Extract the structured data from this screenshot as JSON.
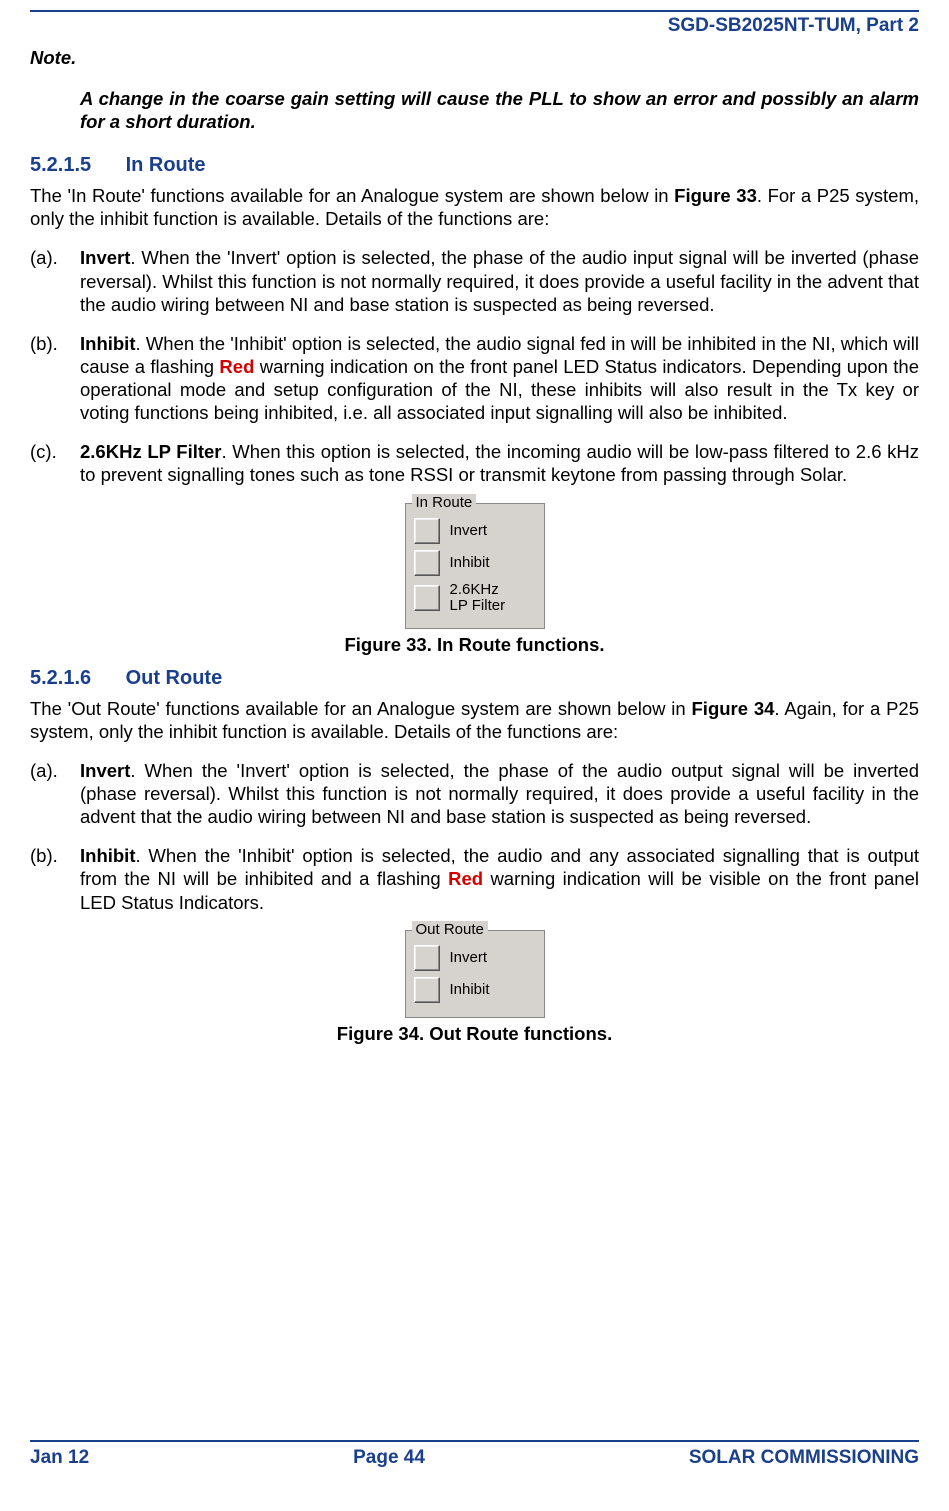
{
  "header": {
    "doc_id": "SGD-SB2025NT-TUM, Part 2"
  },
  "note": {
    "label": "Note.",
    "body": "A change in the coarse gain setting will cause the PLL to show an error and possibly an alarm for a short duration."
  },
  "sec_in_route": {
    "number": "5.2.1.5",
    "title": "In Route",
    "intro_1": "The 'In Route' functions available for an Analogue system are shown below in ",
    "intro_fig": "Figure 33",
    "intro_2": ".  For a P25 system, only the inhibit function is available.  Details of the functions are:",
    "a_marker": "(a).",
    "a_head": "Invert",
    "a_body": ".   When the 'Invert' option is selected, the phase of the audio input signal will be inverted (phase reversal).   Whilst this function is not normally required, it does provide a useful facility in the advent that the audio wiring between NI and base station is suspected as being reversed.",
    "b_marker": "(b).",
    "b_head": "Inhibit",
    "b_body_1": ".  When the 'Inhibit' option is selected, the audio signal fed in will be inhibited in the NI, which will cause a flashing ",
    "b_red": "Red",
    "b_body_2": " warning indication on the front panel LED Status indicators.  Depending upon the operational mode and setup configuration of the NI, these inhibits will also result in the Tx key or voting functions being inhibited, i.e. all associated input signalling will also be inhibited.",
    "c_marker": "(c).",
    "c_head": "2.6KHz LP Filter",
    "c_body": ".  When this option is selected, the incoming audio will be low-pass filtered to 2.6 kHz to prevent signalling tones such as tone RSSI or transmit keytone from passing through Solar."
  },
  "figure33": {
    "groupbox_title": "In Route",
    "opt1": "Invert",
    "opt2": "Inhibit",
    "opt3": "2.6KHz\nLP Filter",
    "caption": "Figure 33.  In Route functions."
  },
  "sec_out_route": {
    "number": "5.2.1.6",
    "title": "Out Route",
    "intro_1": "The 'Out Route' functions available for an Analogue system are shown below in ",
    "intro_fig": "Figure 34",
    "intro_2": ".  Again, for a P25 system, only the inhibit function is available.  Details of the functions are:",
    "a_marker": "(a).",
    "a_head": "Invert",
    "a_body": ".   When the 'Invert' option is selected, the phase of the audio output signal will be inverted (phase reversal).   Whilst this function is not normally required, it does provide a useful facility in the advent that the audio wiring between NI and base station is suspected as being reversed.",
    "b_marker": "(b).",
    "b_head": "Inhibit",
    "b_body_1": ".  When the 'Inhibit' option is selected, the audio and any associated signalling that is output from the NI will be inhibited and a flashing ",
    "b_red": "Red",
    "b_body_2": " warning indication will be visible on the front panel LED Status Indicators."
  },
  "figure34": {
    "groupbox_title": "Out Route",
    "opt1": "Invert",
    "opt2": "Inhibit",
    "caption": "Figure 34.  Out Route functions."
  },
  "footer": {
    "left": "Jan 12",
    "center": "Page 44",
    "right": "SOLAR COMMISSIONING"
  }
}
